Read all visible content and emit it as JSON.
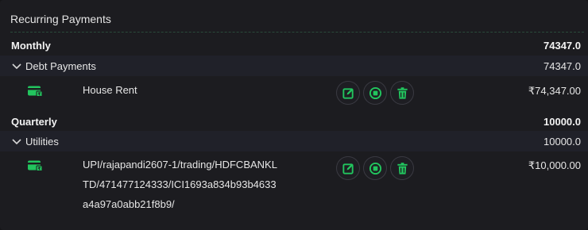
{
  "panel": {
    "title": "Recurring Payments"
  },
  "groups": [
    {
      "label": "Monthly",
      "total": "74347.0",
      "category": {
        "label": "Debt Payments",
        "total": "74347.0"
      },
      "item": {
        "name": "House Rent",
        "amount": "₹74,347.00"
      }
    },
    {
      "label": "Quarterly",
      "total": "10000.0",
      "category": {
        "label": "Utilities",
        "total": "10000.0"
      },
      "item": {
        "name": "UPI/rajapandi2607-1/trading/HDFCBANKLTD/471477124333/ICI1693a834b93b4633a4a97a0abb21f8b9/",
        "amount": "₹10,000.00"
      }
    }
  ],
  "colors": {
    "accent": "#22c55e",
    "background": "#1c1c20",
    "band": "#202129"
  },
  "icons": {
    "payment": "payment-card-icon",
    "edit": "edit-icon",
    "stop": "stop-icon",
    "delete": "trash-icon",
    "expand": "chevron-down-icon"
  }
}
